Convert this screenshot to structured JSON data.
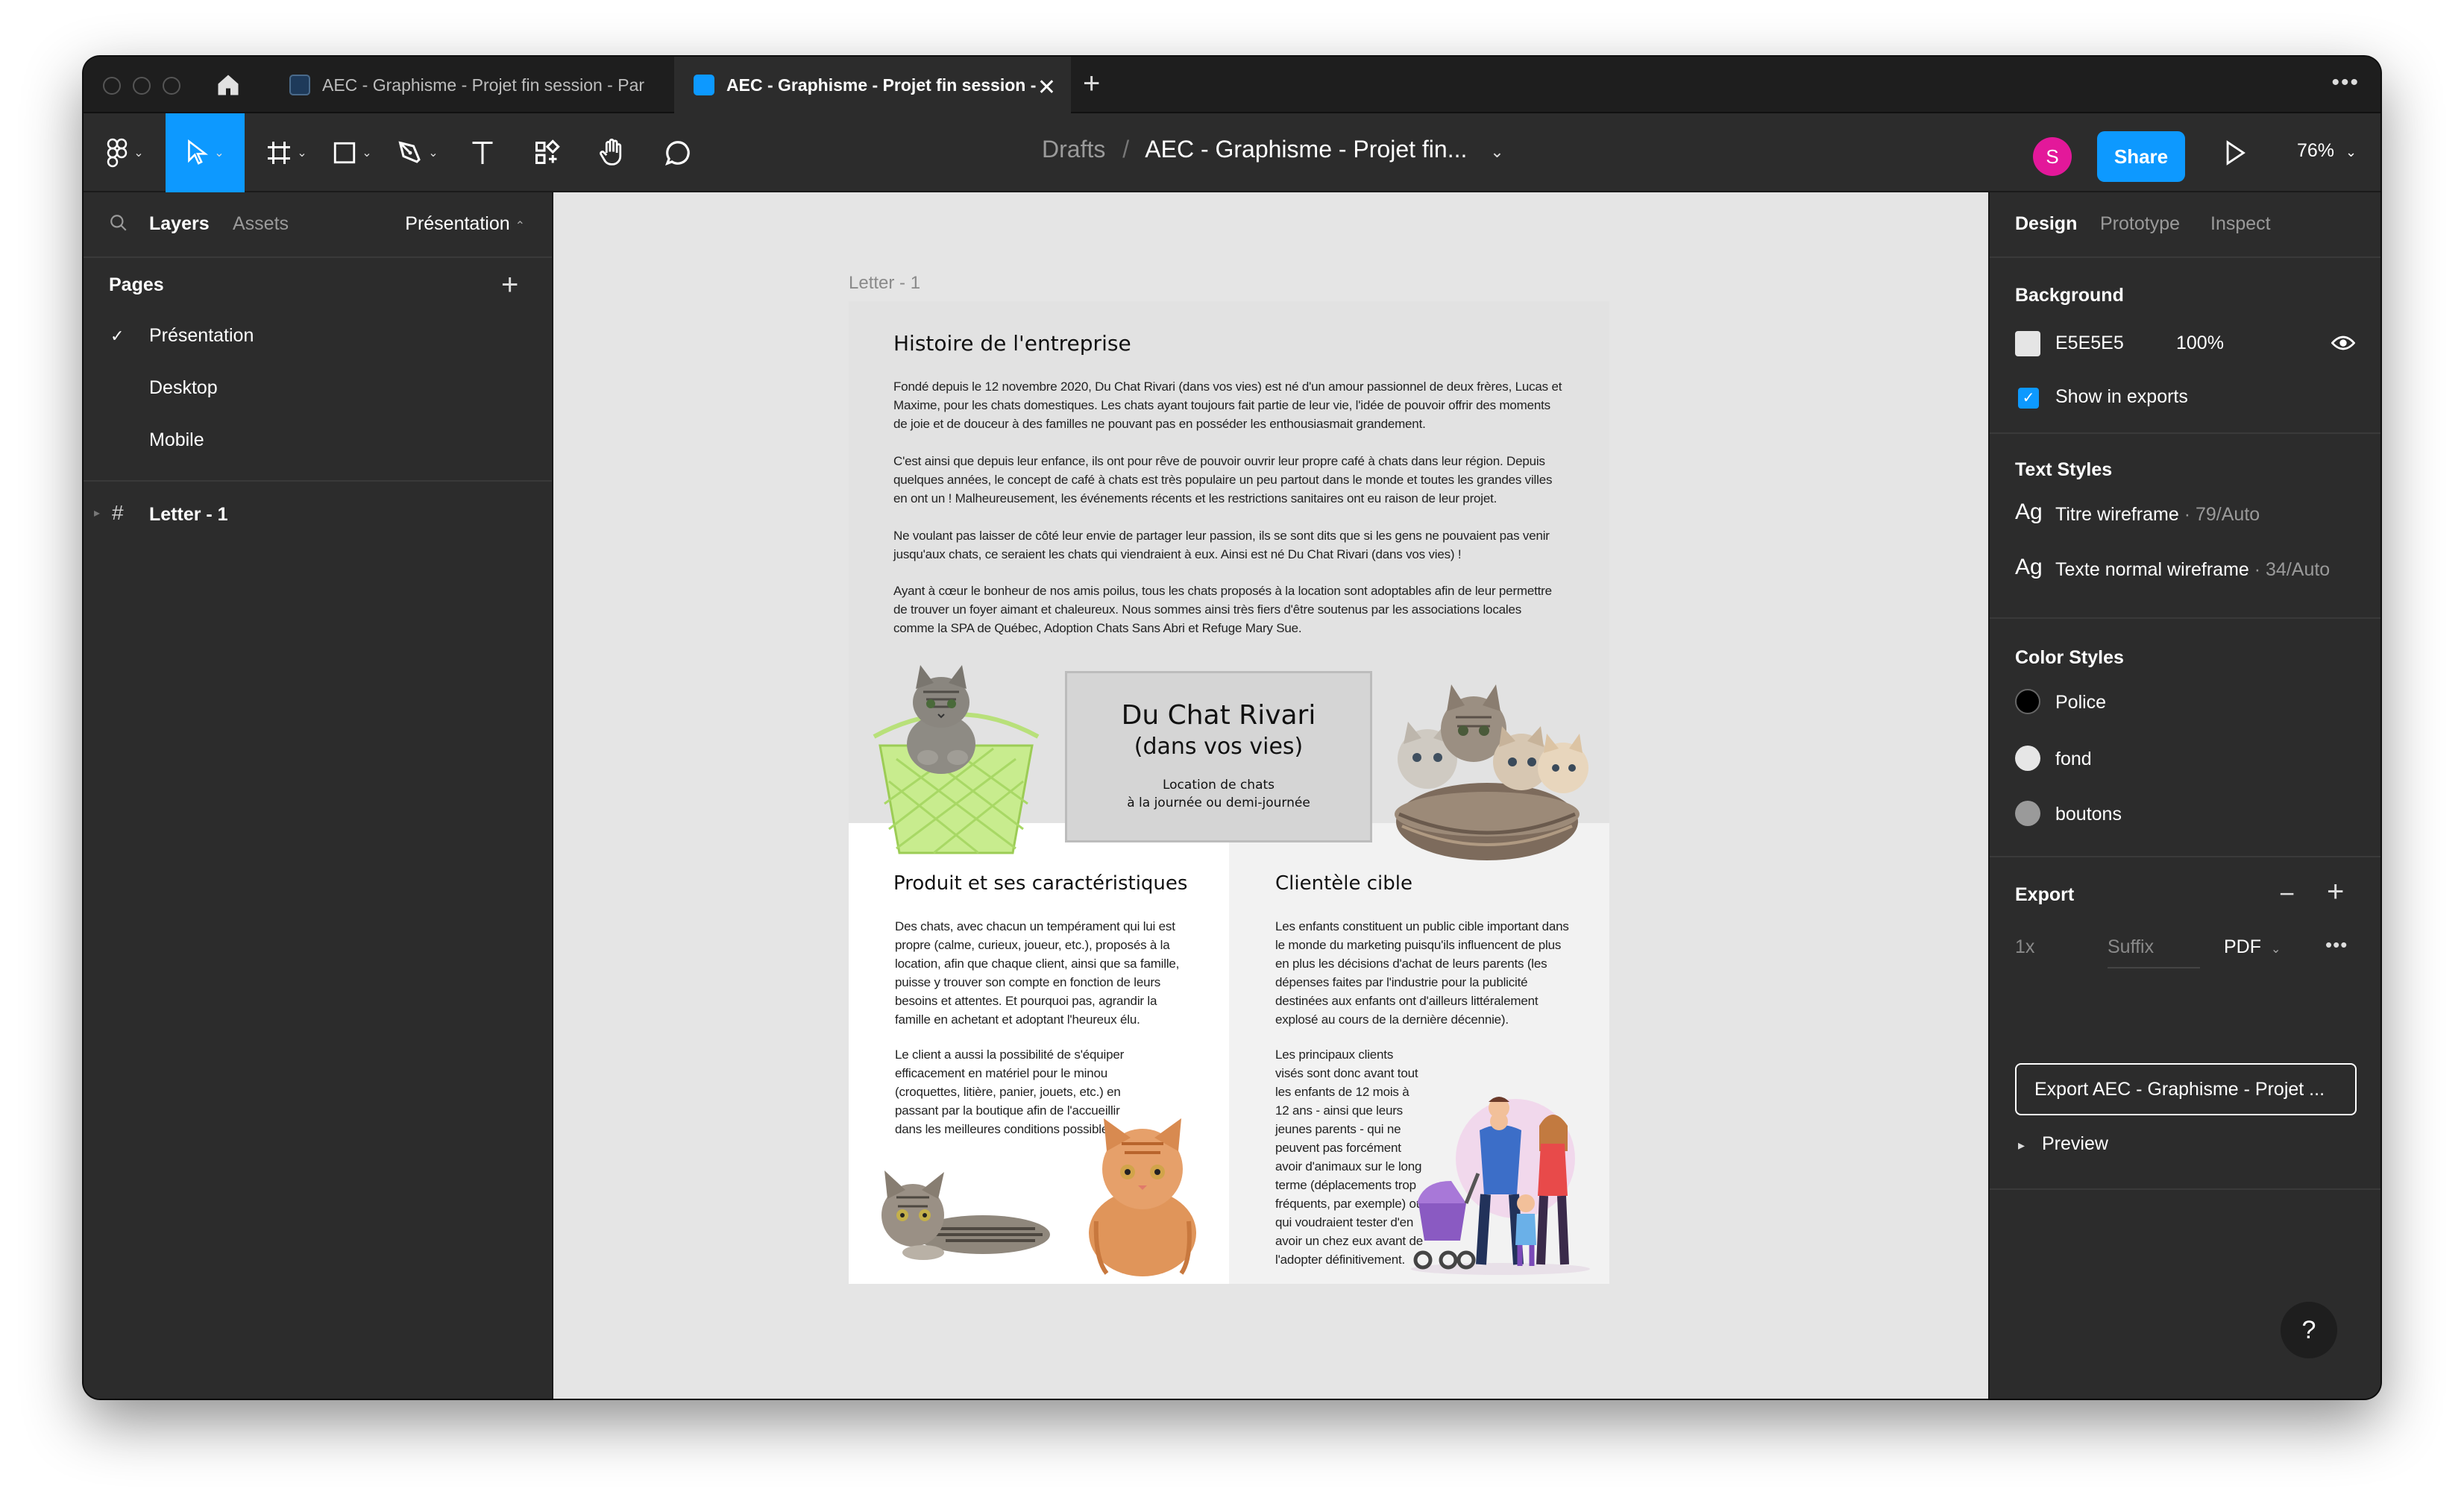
{
  "tabs": [
    {
      "label": "AEC - Graphisme - Projet fin session - Par"
    },
    {
      "label": "AEC - Graphisme - Projet fin session - I"
    }
  ],
  "toolbar": {
    "breadcrumb_root": "Drafts",
    "breadcrumb_sep": "/",
    "file_name": "AEC - Graphisme - Projet fin...",
    "avatar_initial": "S",
    "share_label": "Share",
    "zoom": "76%"
  },
  "left_panel": {
    "tabs": [
      "Layers",
      "Assets"
    ],
    "current_page": "Présentation",
    "pages_title": "Pages",
    "pages": [
      "Présentation",
      "Desktop",
      "Mobile"
    ],
    "layers": [
      "Letter - 1"
    ]
  },
  "canvas": {
    "frame_label": "Letter - 1",
    "histoire_title": "Histoire de l'entreprise",
    "histoire_paragraphs": [
      "Fondé depuis le 12 novembre 2020, Du Chat Rivari (dans vos vies) est né d'un amour passionnel de deux frères, Lucas et Maxime, pour les chats domestiques. Les chats ayant toujours fait partie de leur vie, l'idée de pouvoir offrir des moments de joie et de douceur à des familles ne pouvant pas en posséder les enthousiasmait grandement.",
      "C'est ainsi que depuis leur enfance, ils ont pour rêve de pouvoir ouvrir leur propre café à chats dans leur région. Depuis quelques années, le concept de café à chats est très populaire un peu partout dans le monde et toutes les grandes villes en ont un ! Malheureusement, les événements récents et les restrictions sanitaires ont eu raison de leur projet.",
      "Ne voulant pas laisser de côté leur envie de partager leur passion, ils se sont dits que si les gens ne pouvaient pas venir jusqu'aux chats, ce seraient les chats qui viendraient à eux. Ainsi est né Du Chat Rivari (dans vos vies) !",
      "Ayant à cœur le bonheur de nos amis poilus, tous les chats proposés à la location sont adoptables afin de leur permettre de trouver un foyer aimant et chaleureux. Nous sommes ainsi très fiers d'être soutenus par les associations locales comme la SPA de Québec, Adoption Chats Sans Abri et Refuge Mary Sue."
    ],
    "logo_line1": "Du Chat Rivari",
    "logo_line2": "(dans vos vies)",
    "logo_sub1": "Location de chats",
    "logo_sub2": "à la journée ou demi-journée",
    "produit_title": "Produit et ses caractéristiques",
    "produit_p1": "Des chats, avec chacun un tempérament qui lui est propre (calme, curieux, joueur, etc.), proposés à la location, afin que chaque client, ainsi que sa famille, puisse y trouver son compte en fonction de leurs besoins et attentes. Et pourquoi pas, agrandir la famille en achetant et adoptant l'heureux élu.",
    "produit_p2": "Le client a aussi la possibilité de s'équiper efficacement en matériel pour le minou (croquettes, litière, panier, jouets, etc.) en passant par la boutique afin de l'accueillir dans les meilleures conditions possibles.",
    "clientele_title": "Clientèle cible",
    "clientele_p1": "Les enfants constituent un public cible important dans le monde du marketing puisqu'ils influencent de plus en plus les décisions d'achat de leurs parents (les dépenses faites par l'industrie pour la publicité destinées aux enfants ont d'ailleurs littéralement explosé au cours de la dernière décennie).",
    "clientele_p2": "Les principaux clients visés sont donc avant tout les enfants de 12 mois à 12 ans - ainsi que leurs jeunes parents - qui ne peuvent pas forcément avoir d'animaux sur le long terme (déplacements trop fréquents, par exemple) ou qui voudraient tester d'en avoir un chez eux avant de l'adopter définitivement."
  },
  "right_panel": {
    "tabs": [
      "Design",
      "Prototype",
      "Inspect"
    ],
    "background_title": "Background",
    "bg_hex": "E5E5E5",
    "bg_opacity": "100%",
    "show_in_exports": "Show in exports",
    "text_styles_title": "Text Styles",
    "text_styles": [
      {
        "glyph": "Ag",
        "name": "Titre wireframe",
        "meta": " · 79/Auto"
      },
      {
        "glyph": "Ag",
        "name": "Texte normal wireframe",
        "meta": " · 34/Auto"
      }
    ],
    "color_styles_title": "Color Styles",
    "color_styles": [
      {
        "name": "Police",
        "color": "#000000"
      },
      {
        "name": "fond",
        "color": "#e6e6e6"
      },
      {
        "name": "boutons",
        "color": "#9a9a9a"
      }
    ],
    "export_title": "Export",
    "export_scale": "1x",
    "export_suffix": "Suffix",
    "export_format": "PDF",
    "export_button": "Export AEC - Graphisme - Projet ...",
    "preview_label": "Preview",
    "help": "?"
  },
  "colors": {
    "accent": "#0d99ff",
    "panel": "#2c2c2c",
    "canvas": "#e5e5e5",
    "avatar": "#e3189a"
  }
}
